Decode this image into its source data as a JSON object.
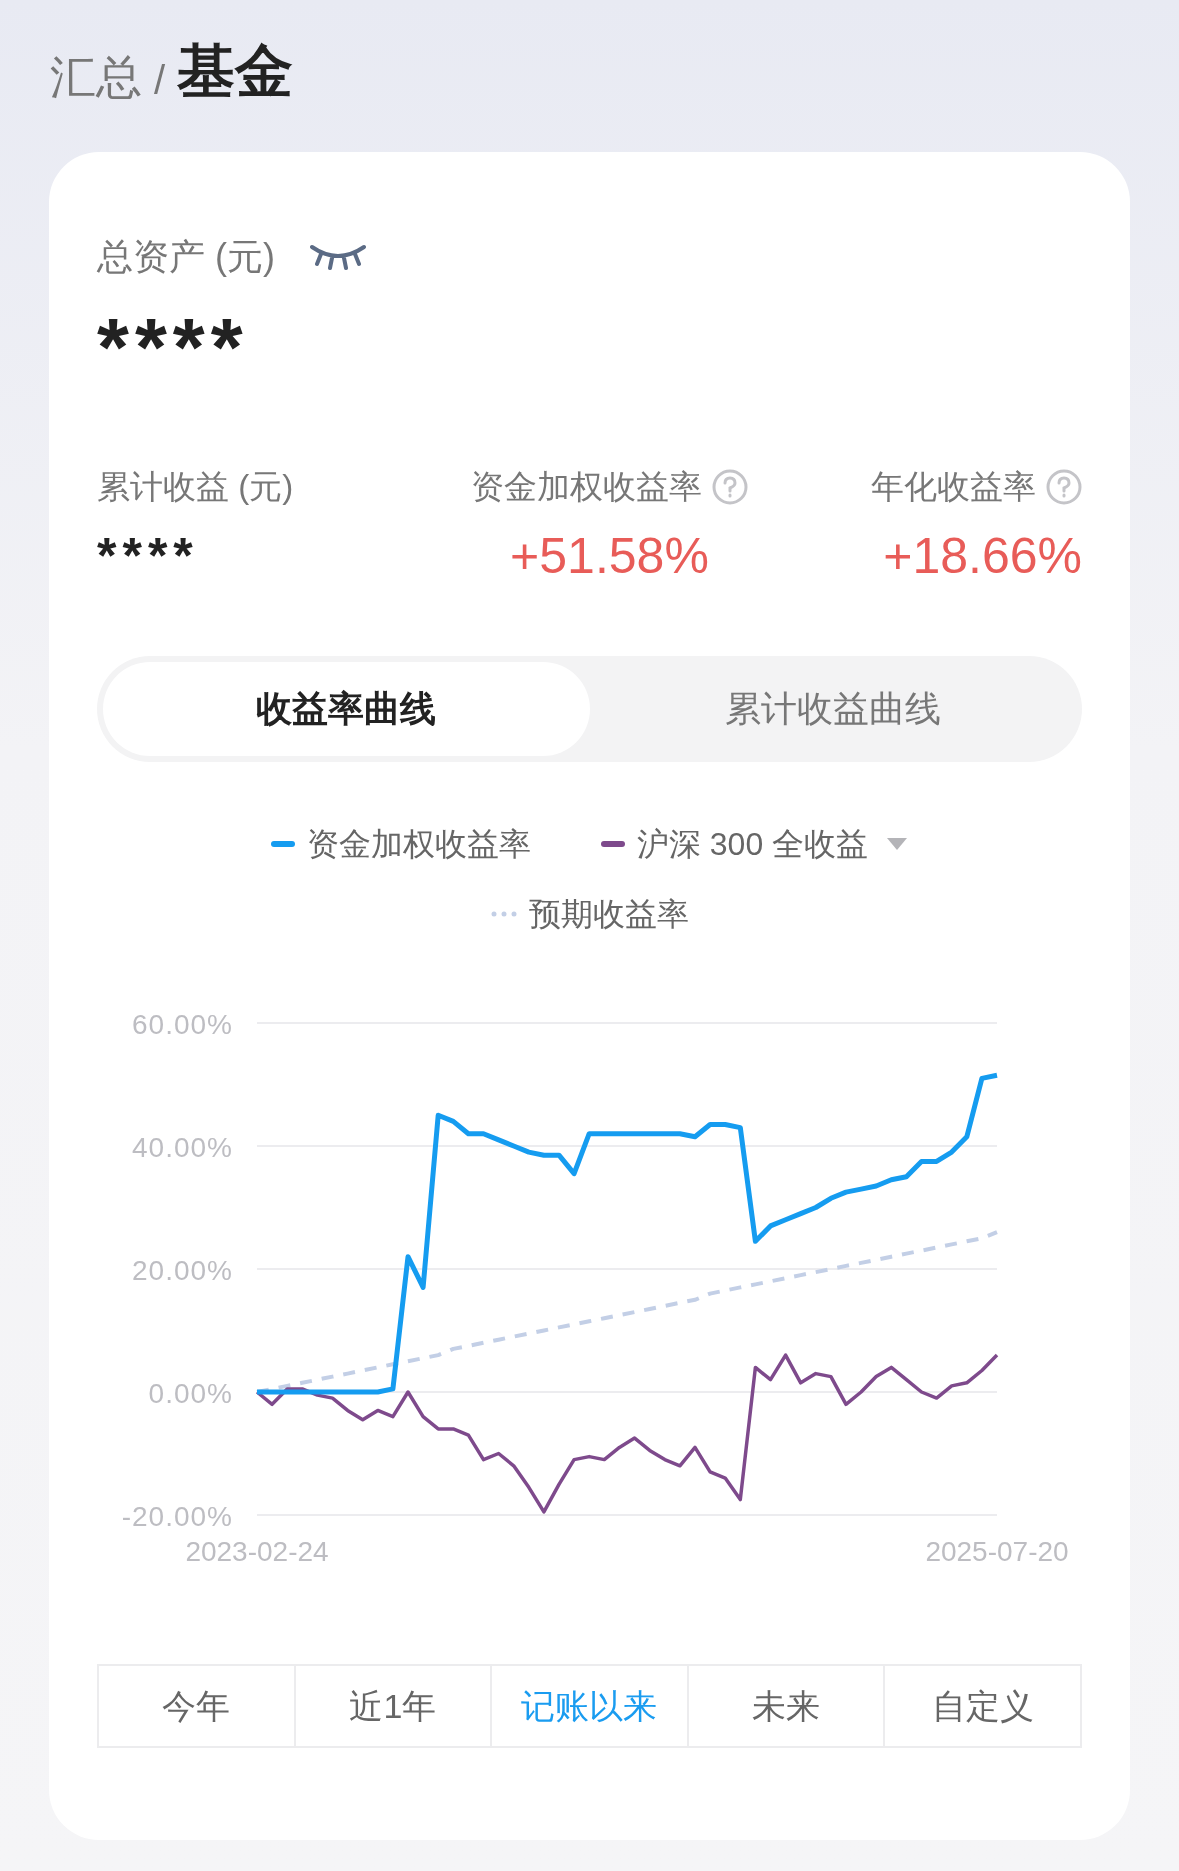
{
  "breadcrumb": {
    "parent": "汇总",
    "separator": "/",
    "current": "基金"
  },
  "total_assets": {
    "label": "总资产 (元)",
    "value": "****",
    "hidden": true
  },
  "metrics": [
    {
      "label": "累计收益 (元)",
      "value": "****",
      "kind": "masked"
    },
    {
      "label": "资金加权收益率",
      "value": "+51.58%",
      "kind": "gain",
      "help": true
    },
    {
      "label": "年化收益率",
      "value": "+18.66%",
      "kind": "gain",
      "help": true
    }
  ],
  "curve_tabs": [
    {
      "label": "收益率曲线",
      "selected": true
    },
    {
      "label": "累计收益曲线",
      "selected": false
    }
  ],
  "benchmark_menu": {
    "expanded": false
  },
  "chart_data": {
    "type": "line",
    "grid": true,
    "ylim": [
      -20,
      60
    ],
    "categories": [
      "2023-02-24",
      null,
      null,
      null,
      null,
      null,
      null,
      null,
      null,
      null,
      null,
      null,
      null,
      null,
      null,
      null,
      null,
      null,
      null,
      null,
      null,
      null,
      null,
      null,
      null,
      null,
      null,
      null,
      null,
      null,
      null,
      null,
      null,
      null,
      null,
      null,
      null,
      null,
      null,
      null,
      null,
      null,
      null,
      null,
      null,
      null,
      null,
      null,
      null,
      "2025-07-20"
    ],
    "yticks": [
      {
        "value": 60,
        "label": "60.00%"
      },
      {
        "value": 40,
        "label": "40.00%"
      },
      {
        "value": 20,
        "label": "20.00%"
      },
      {
        "value": 0,
        "label": "0.00%"
      },
      {
        "value": -20,
        "label": "-20.00%"
      }
    ],
    "series": [
      {
        "name": "资金加权收益率",
        "color": "#159cf0",
        "line_style": "solid",
        "values": [
          0,
          0,
          0,
          0,
          0,
          0,
          0,
          0,
          0,
          0.5,
          22,
          17,
          45,
          44,
          42,
          42,
          41,
          40,
          39,
          38.5,
          38.5,
          35.5,
          42,
          42,
          42,
          42,
          42,
          42,
          42,
          41.5,
          43.5,
          43.5,
          43,
          24.5,
          27,
          28,
          29,
          30,
          31.5,
          32.5,
          33,
          33.5,
          34.5,
          35,
          37.5,
          37.5,
          39,
          41.5,
          51,
          51.5
        ]
      },
      {
        "name": "沪深 300 全收益",
        "color": "#7e4a8c",
        "line_style": "solid",
        "values": [
          0,
          -2,
          0.5,
          0.5,
          -0.5,
          -1,
          -3,
          -4.5,
          -3,
          -4,
          0,
          -4,
          -6,
          -6,
          -7,
          -11,
          -10,
          -12,
          -15.5,
          -19.5,
          -15,
          -11,
          -10.5,
          -11,
          -9,
          -7.5,
          -9.5,
          -11,
          -12,
          -9,
          -13,
          -14,
          -17.5,
          4,
          2,
          6,
          1.5,
          3,
          2.5,
          -2,
          0,
          2.5,
          4,
          2,
          0,
          -1,
          1,
          1.5,
          3.5,
          6
        ]
      },
      {
        "name": "预期收益率",
        "color": "#c3cfe6",
        "line_style": "dashed",
        "values": [
          0,
          0.5,
          1,
          1.5,
          2,
          2.5,
          3,
          3.5,
          4,
          4.5,
          5,
          5.5,
          6,
          7,
          7.5,
          8,
          8.5,
          9,
          9.5,
          10,
          10.5,
          11,
          11.5,
          12,
          12.5,
          13,
          13.5,
          14,
          14.5,
          15,
          16,
          16.5,
          17,
          17.5,
          18,
          18.5,
          19,
          19.5,
          20,
          20.5,
          21,
          21.5,
          22,
          22.5,
          23,
          23.5,
          24,
          24.5,
          25,
          26
        ]
      }
    ]
  },
  "range_tabs": [
    {
      "label": "今年",
      "selected": false
    },
    {
      "label": "近1年",
      "selected": false
    },
    {
      "label": "记账以来",
      "selected": true
    },
    {
      "label": "未来",
      "selected": false
    },
    {
      "label": "自定义",
      "selected": false
    }
  ]
}
